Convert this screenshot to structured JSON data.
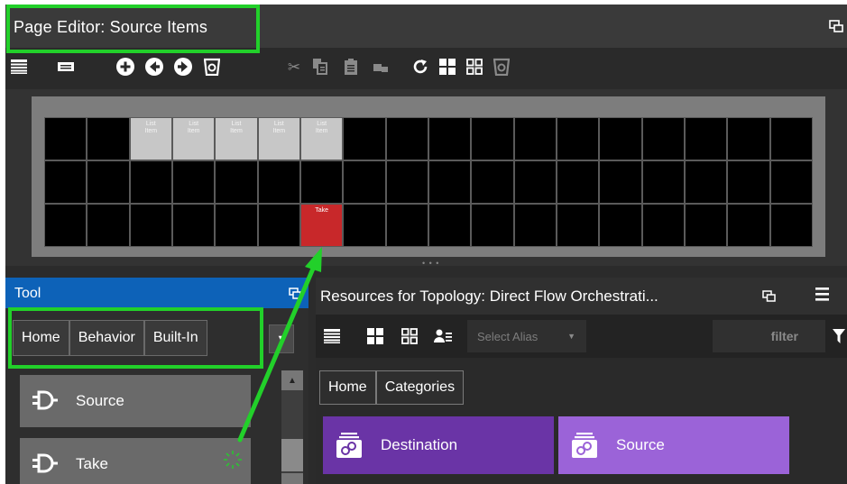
{
  "page_editor": {
    "title": "Page Editor: Source Items"
  },
  "toolbar": {
    "icons": [
      "list-view-icon",
      "keyboard-icon",
      "add-icon",
      "back-icon",
      "forward-icon",
      "layer-icon",
      "cut-icon",
      "copy-icon",
      "paste-icon",
      "duplicate-icon",
      "refresh-icon",
      "grid-large-icon",
      "grid-small-icon",
      "layer-dim-icon"
    ]
  },
  "grid": {
    "rows": 3,
    "cols": 18,
    "list_item_label": "List Item",
    "take_label": "Take"
  },
  "tool_panel": {
    "title": "Tool",
    "breadcrumbs": [
      "Home",
      "Behavior",
      "Built-In"
    ],
    "items": [
      {
        "label": "Source"
      },
      {
        "label": "Take"
      }
    ]
  },
  "resources_panel": {
    "title": "Resources for Topology: Direct Flow Orchestrati...",
    "alias_placeholder": "Select Alias",
    "filter_placeholder": "filter",
    "breadcrumbs": [
      "Home",
      "Categories"
    ],
    "categories": [
      {
        "label": "Destination",
        "color": "#6a34a6"
      },
      {
        "label": "Source",
        "color": "#9b63d8"
      }
    ]
  },
  "colors": {
    "highlight": "#22d02a",
    "tool_header": "#0d62b8",
    "take_cell": "#c8282a",
    "list_cell": "#c7c7c7"
  }
}
